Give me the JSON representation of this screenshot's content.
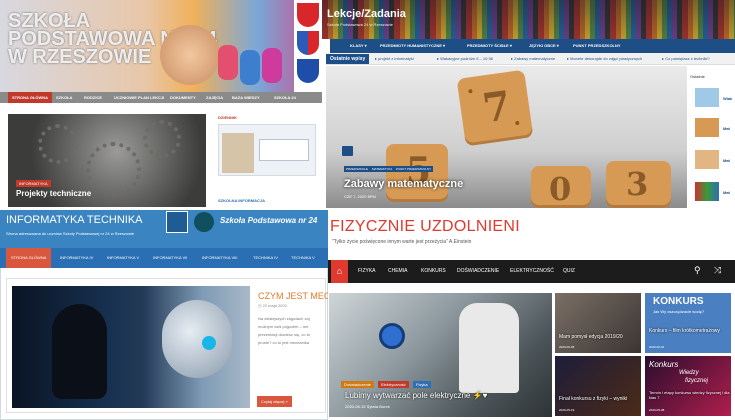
{
  "panel1": {
    "hero_title": "SZKOŁA PODSTAWOWA NR 24 W RZESZOWIE",
    "nav": [
      "STRONA GŁÓWNA",
      "SZKOŁA",
      "RODZICE",
      "UCZNIOWIE",
      "PLAN LEKCJI",
      "DOKUMENTY",
      "ZAJĘCIA",
      "BAZA WIEDZY",
      "SZKOŁA 24"
    ],
    "badge": "INFORMATYKA",
    "caption": "Projekty techniczne",
    "sidebar_title": "DZIENNIK",
    "sidebar_bottom": "SZKOLNA INFORMACJA"
  },
  "panel2": {
    "title": "Lekcje/Zadania",
    "subtitle": "Szkoła Podstawowa 24 w Rzeszowie",
    "nav": [
      "KLASY",
      "PRZEDMIOTY HUMANISTYCZNE",
      "PRZEDMIOTY ŚCISŁE",
      "JĘZYKI OBCE",
      "PUNKT PRZEDSZKOLNY"
    ],
    "ticker_label": "Ostatnie wpisy",
    "ticker": [
      "projekt z informatyki",
      "Wakacyjne podróże 5 – 10:36",
      "Zabawy matematyczne",
      "Monete dekorajde do zajęć plastycznych",
      "Co pamiętasz z techniki?"
    ],
    "chips": [
      "PRZEDSZKOLE",
      "MATEMATYKA",
      "PUNKT PRZEDSZKOLNY"
    ],
    "hero_title": "Zabawy matematyczne",
    "hero_meta": "CZE 7, 2020   6PM",
    "hero_numbers": [
      "7",
      "5",
      "0",
      "3"
    ],
    "side_head": "Ostatnie",
    "side_items": [
      "Wiak",
      "Mat",
      "Mat",
      "Mat"
    ]
  },
  "panel3": {
    "title": "INFORMATYKA TECHNIKA",
    "subtitle": "Strona adresowana do uczniów Szkoły Podstawowej nr 24 w Rzeszowie",
    "logo_text": "Szkoła Podstawowa nr 24",
    "nav": [
      "STRONA GŁÓWNA",
      "INFORMATYKA IV",
      "INFORMATYKA V",
      "INFORMATYKA VII",
      "INFORMATYKA VIII",
      "TECHNIKA IV",
      "TECHNIKA V"
    ],
    "article_title": "CZYM JEST MECHA",
    "article_date": "22 maja 2020",
    "article_lines": [
      "Na dzisiejszych zajęciach zaj",
      "możnym dziś pojęciem – me",
      "prezentacji dowiesz się, co to",
      "proste? co to jest mechanika"
    ],
    "read_more": "Czytaj więcej »"
  },
  "panel4": {
    "title": "FIZYCZNIE UZDOLNIENI",
    "quote": "\"Tylko życie poświęcone innym warte jest przeżycia\" A.Einstein",
    "nav": [
      "FIZYKA",
      "CHEMIA",
      "KONKURS",
      "DOŚWIADCZENIE",
      "ELEKTRYCZNOŚĆ",
      "QUIZ"
    ],
    "chips": [
      "Doświadczenie",
      "Elektryczność",
      "Fizyka"
    ],
    "main_title": "Lubimy wytwarzać pole elektryczne ⚡♥",
    "main_meta": "2020-06-15   Sylwia Burek",
    "tiles": [
      {
        "title": "Mam pomysł edycja 2019/20",
        "date": "2020-06-05"
      },
      {
        "title": "Konkurs – film krótkometrażowy",
        "date": "2020-06-01"
      },
      {
        "title": "Finał konkursu z fizyki – wyniki",
        "date": "2020-05-19"
      },
      {
        "title": "Termin i etapy konkursu wiedzy fizycznej i dla klas 7",
        "date": "2020-05-08"
      }
    ],
    "tile_overlay_texts": [
      "KONKURS",
      "Jak Wy oszczędzacie wodę?",
      "Konkurs",
      "Wiedzy",
      "fizycznej"
    ]
  },
  "colors": {
    "red": "#e03a2e",
    "blue": "#1d4e86",
    "orange": "#d9573c"
  }
}
